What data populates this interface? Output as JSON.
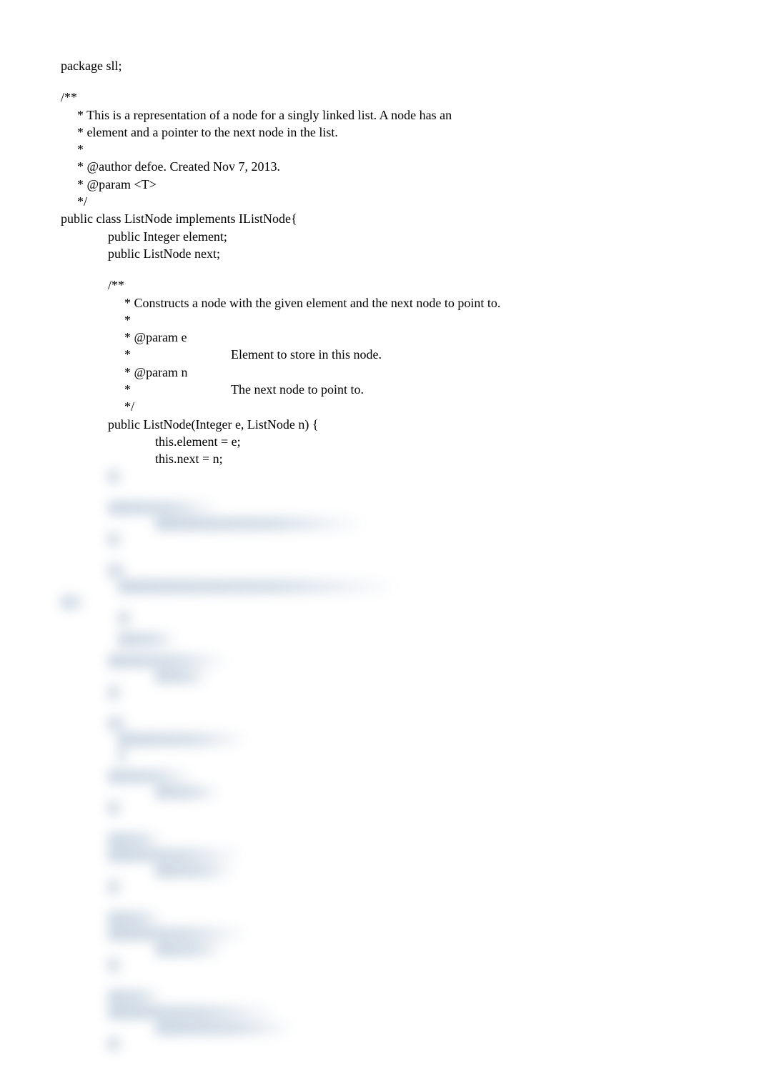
{
  "lines": {
    "l01": "package sll;",
    "l02": "",
    "l03": "/**",
    "l04": "  * This is a representation of a node for a singly linked list. A node has an",
    "l05": "  * element and a pointer to the next node in the list.",
    "l06": "  *",
    "l07": "  * @author defoe. Created Nov 7, 2013.",
    "l08": "  * @param <T>",
    "l09": "  */",
    "l10": "public class ListNode implements IListNode{",
    "l11": "public Integer element;",
    "l12": "public ListNode next;",
    "l13": "",
    "l14": "/**",
    "l15": "  * Constructs a node with the given element and the next node to point to.",
    "l16": "  *",
    "l17": "  * @param e",
    "l18a": "  *",
    "l18b": "Element to store in this node.",
    "l19": "  * @param n",
    "l20a": "  *",
    "l20b": "The next node to point to.",
    "l21": "  */",
    "l22": "public ListNode(Integer e, ListNode n) {",
    "l23": "this.element = e;",
    "l24": "this.next = n;"
  },
  "blurred_hint": "Additional methods (clone, constructors, getElement, getNext, setNext) are present below but obscured."
}
